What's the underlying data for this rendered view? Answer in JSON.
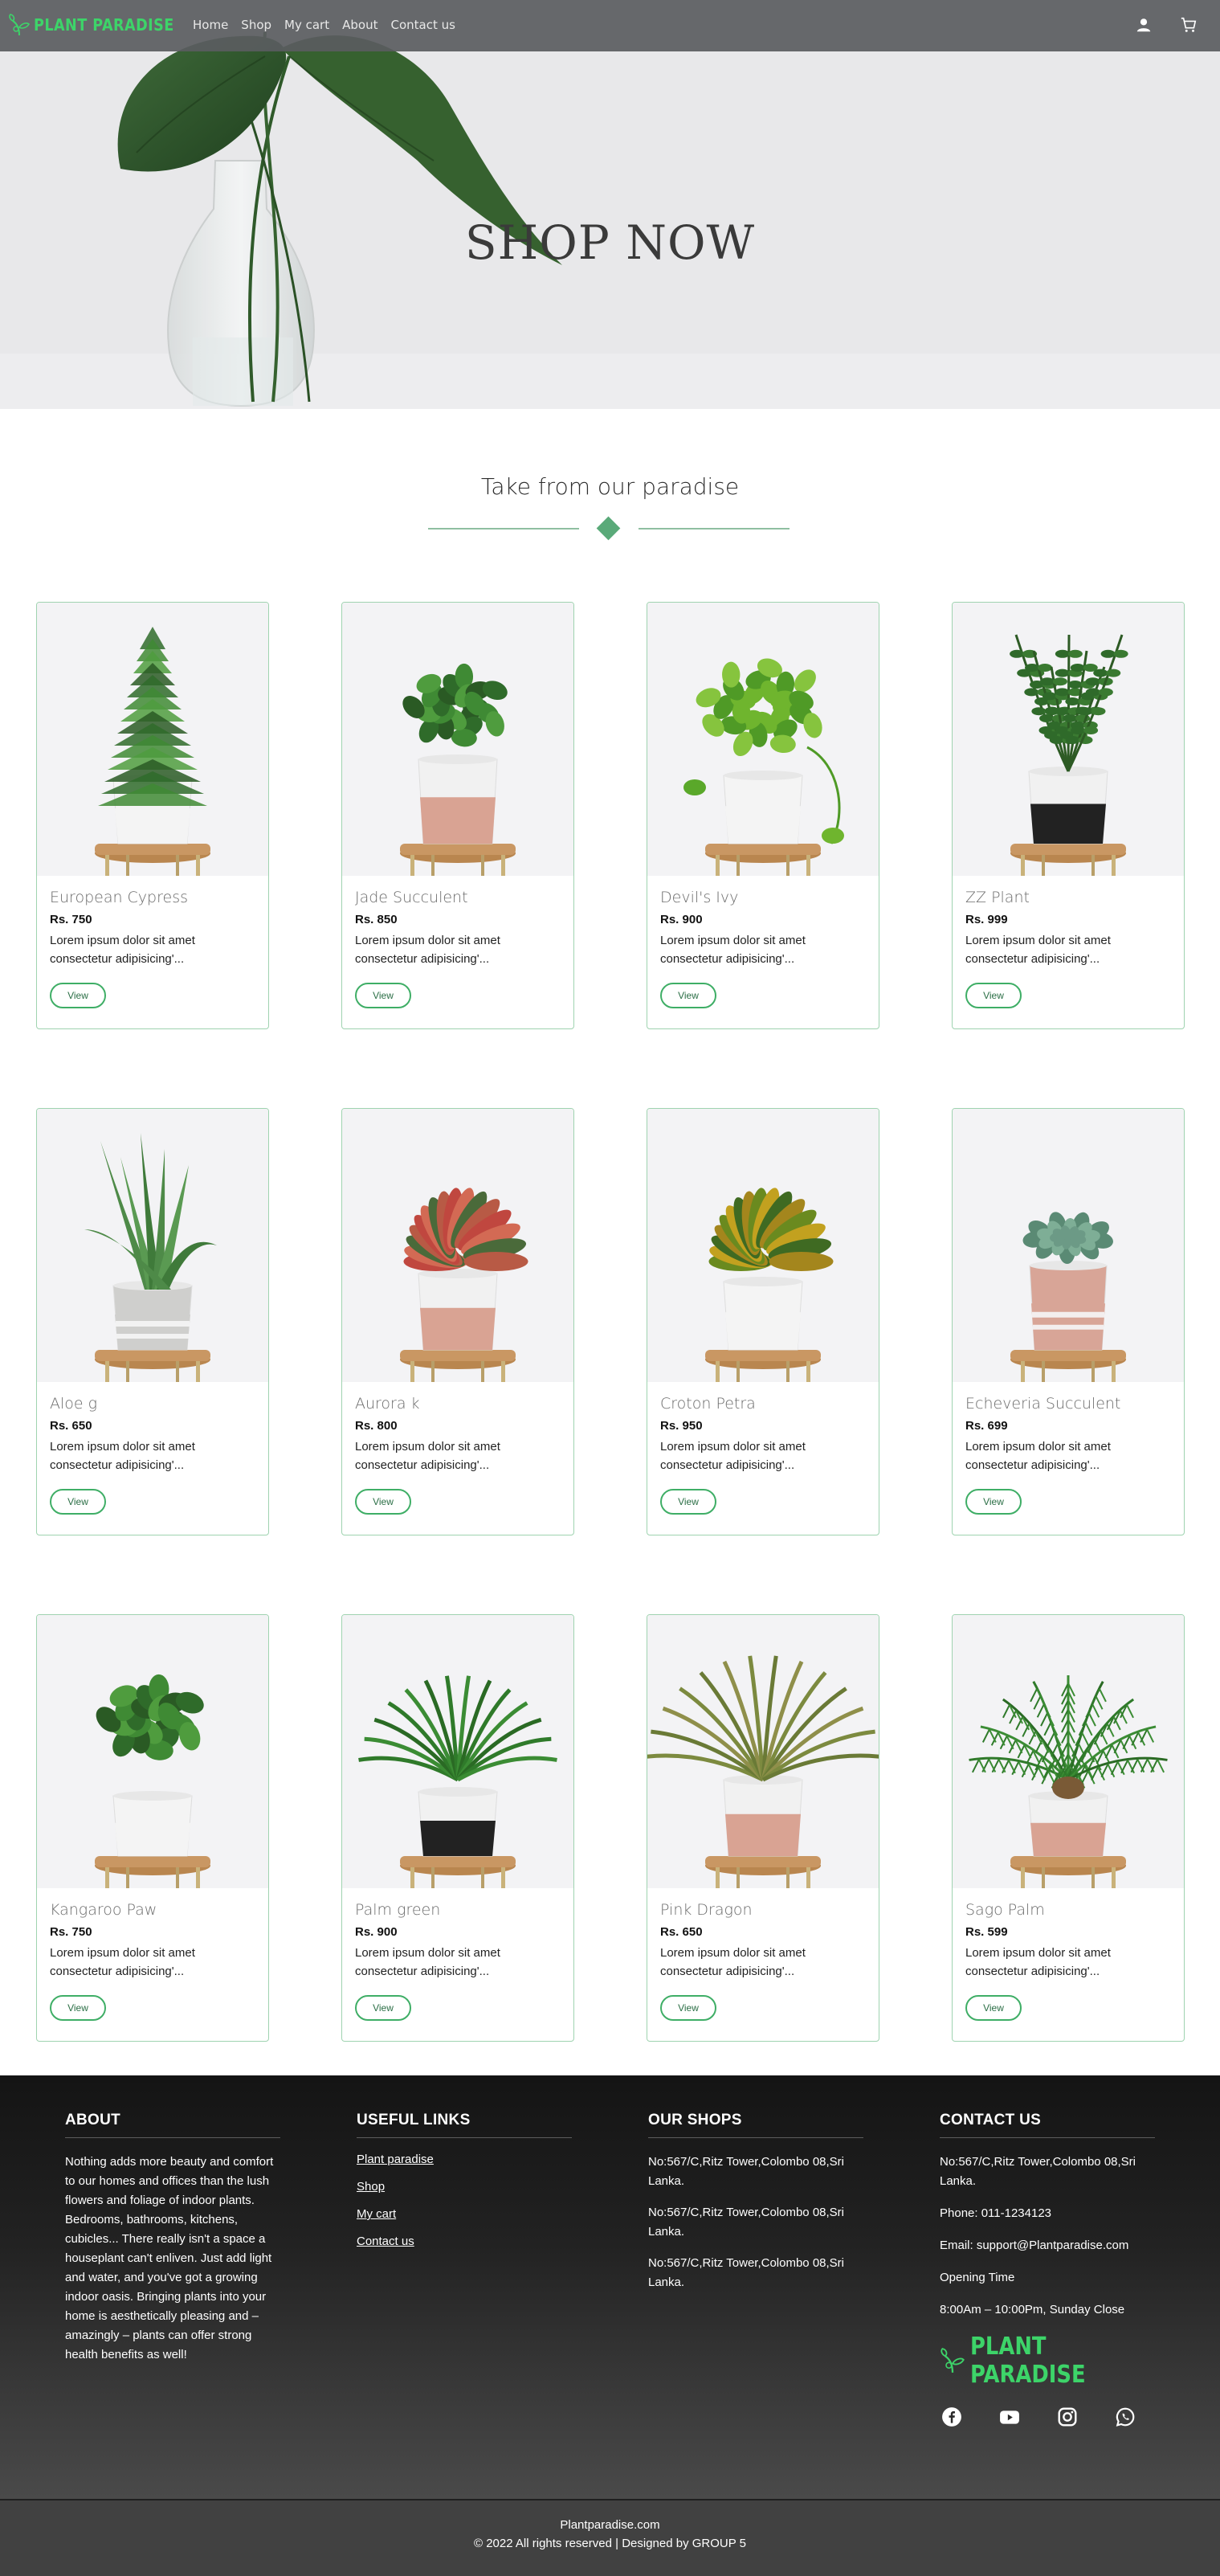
{
  "nav": {
    "brand": "PLANT PARADISE",
    "links": [
      "Home",
      "Shop",
      "My cart",
      "About",
      "Contact us"
    ],
    "icons": [
      "user-icon",
      "cart-icon"
    ]
  },
  "hero": {
    "title": "SHOP NOW"
  },
  "section": {
    "title": "Take from our paradise"
  },
  "products": [
    {
      "name": "European Cypress",
      "price": "Rs. 750",
      "desc": "Lorem ipsum dolor sit amet consectetur adipisicing'...",
      "view": "View",
      "plant": "cypress",
      "pot": "white"
    },
    {
      "name": "Jade Succulent",
      "price": "Rs. 850",
      "desc": "Lorem ipsum dolor sit amet consectetur adipisicing'...",
      "view": "View",
      "plant": "jade",
      "pot": "pink"
    },
    {
      "name": "Devil's Ivy",
      "price": "Rs. 900",
      "desc": "Lorem ipsum dolor sit amet consectetur adipisicing'...",
      "view": "View",
      "plant": "ivy",
      "pot": "white"
    },
    {
      "name": "ZZ Plant",
      "price": "Rs. 999",
      "desc": "Lorem ipsum dolor sit amet consectetur adipisicing'...",
      "view": "View",
      "plant": "zz",
      "pot": "black"
    },
    {
      "name": "Aloe g",
      "price": "Rs. 650",
      "desc": "Lorem ipsum dolor sit amet consectetur adipisicing'...",
      "view": "View",
      "plant": "aloe",
      "pot": "gray"
    },
    {
      "name": "Aurora k",
      "price": "Rs. 800",
      "desc": "Lorem ipsum dolor sit amet consectetur adipisicing'...",
      "view": "View",
      "plant": "aurora",
      "pot": "pink"
    },
    {
      "name": "Croton Petra",
      "price": "Rs. 950",
      "desc": "Lorem ipsum dolor sit amet consectetur adipisicing'...",
      "view": "View",
      "plant": "croton",
      "pot": "white"
    },
    {
      "name": "Echeveria Succulent",
      "price": "Rs. 699",
      "desc": "Lorem ipsum dolor sit amet consectetur adipisicing'...",
      "view": "View",
      "plant": "echeveria",
      "pot": "pinkstripe"
    },
    {
      "name": "Kangaroo Paw",
      "price": "Rs. 750",
      "desc": "Lorem ipsum dolor sit amet consectetur adipisicing'...",
      "view": "View",
      "plant": "fern",
      "pot": "white"
    },
    {
      "name": "Palm green",
      "price": "Rs. 900",
      "desc": "Lorem ipsum dolor sit amet consectetur adipisicing'...",
      "view": "View",
      "plant": "palm",
      "pot": "black"
    },
    {
      "name": "Pink Dragon",
      "price": "Rs. 650",
      "desc": "Lorem ipsum dolor sit amet consectetur adipisicing'...",
      "view": "View",
      "plant": "dragon",
      "pot": "pink"
    },
    {
      "name": "Sago Palm",
      "price": "Rs. 599",
      "desc": "Lorem ipsum dolor sit amet consectetur adipisicing'...",
      "view": "View",
      "plant": "sago",
      "pot": "pink"
    }
  ],
  "footer": {
    "about": {
      "title": "ABOUT",
      "text": "Nothing adds more beauty and comfort to our homes and offices than the lush flowers and foliage of indoor plants. Bedrooms, bathrooms, kitchens, cubicles... There really isn't a space a houseplant can't enliven. Just add light and water, and you've got a growing indoor oasis. Bringing plants into your home is aesthetically pleasing and – amazingly – plants can offer strong health benefits as well!"
    },
    "links": {
      "title": "USEFUL LINKS",
      "items": [
        "Plant paradise",
        "Shop",
        "My cart",
        "Contact us"
      ]
    },
    "shops": {
      "title": "OUR SHOPS",
      "items": [
        "No:567/C,Ritz Tower,Colombo 08,Sri Lanka.",
        "No:567/C,Ritz Tower,Colombo 08,Sri Lanka.",
        "No:567/C,Ritz Tower,Colombo 08,Sri Lanka."
      ]
    },
    "contact": {
      "title": "CONTACT US",
      "address": "No:567/C,Ritz Tower,Colombo 08,Sri Lanka.",
      "phone": "Phone: 011-1234123",
      "email": "Email: support@Plantparadise.com",
      "opening_label": "Opening Time",
      "opening_hours": "8:00Am – 10:00Pm, Sunday Close",
      "logo_text": "PLANT PARADISE",
      "social": [
        "facebook-icon",
        "youtube-icon",
        "instagram-icon",
        "whatsapp-icon"
      ]
    }
  },
  "copyright": {
    "site": "Plantparadise.com",
    "text": "© 2022 All rights reserved | Designed by GROUP 5"
  },
  "colors": {
    "brand_green": "#3dd469",
    "accent_green": "#5aaa79",
    "card_border": "#9fd3b0",
    "button_border": "#3fae66"
  }
}
